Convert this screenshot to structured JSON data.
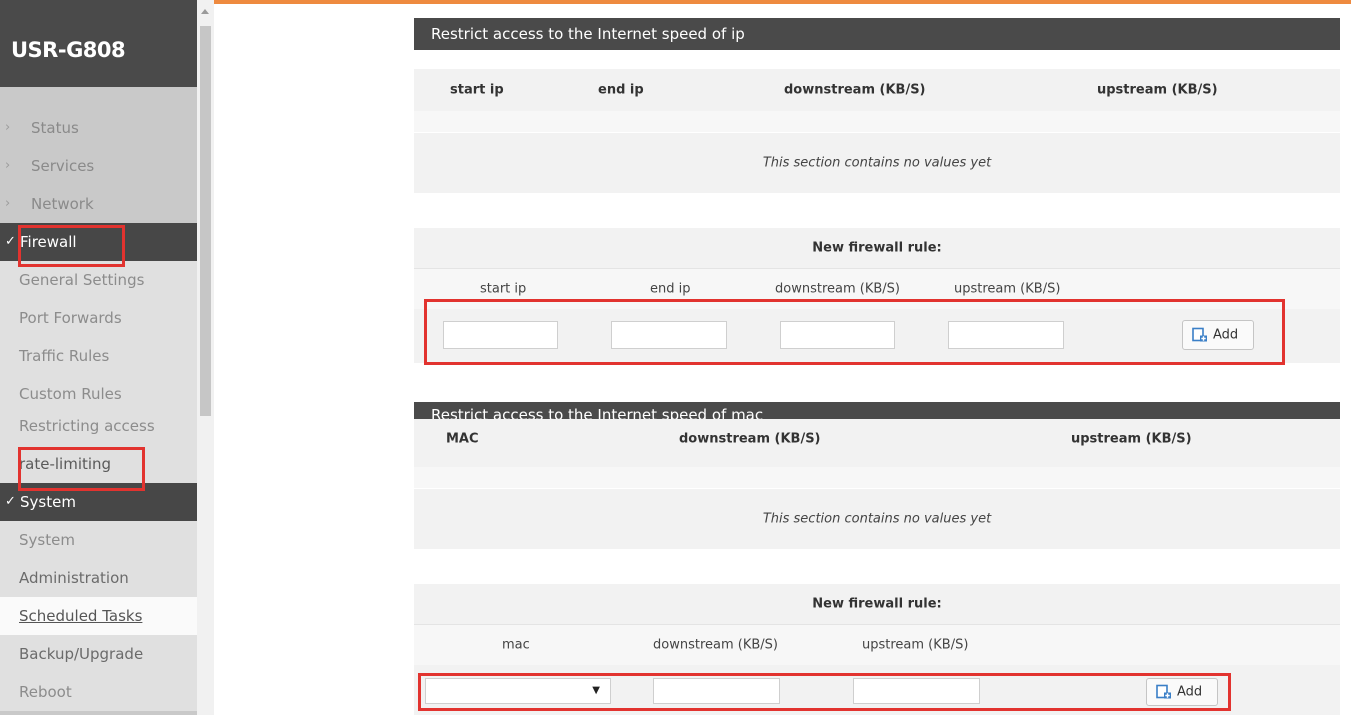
{
  "app": {
    "title": "USR-G808"
  },
  "sidebar": {
    "items": [
      {
        "label": "Status"
      },
      {
        "label": "Services"
      },
      {
        "label": "Network"
      },
      {
        "label": "Firewall"
      },
      {
        "label": "General Settings"
      },
      {
        "label": "Port Forwards"
      },
      {
        "label": "Traffic Rules"
      },
      {
        "label": "Custom Rules"
      },
      {
        "label": "Restricting access"
      },
      {
        "label": "rate-limiting"
      },
      {
        "label": "System"
      },
      {
        "label": "System"
      },
      {
        "label": "Administration"
      },
      {
        "label": "Scheduled Tasks"
      },
      {
        "label": "Backup/Upgrade"
      },
      {
        "label": "Reboot"
      }
    ]
  },
  "ip_section": {
    "title": "Restrict access to the Internet speed of ip",
    "columns": [
      "start ip",
      "end ip",
      "downstream (KB/S)",
      "upstream (KB/S)"
    ],
    "empty_message": "This section contains no values yet",
    "new_rule_title": "New firewall rule:",
    "new_rule_columns": [
      "start ip",
      "end ip",
      "downstream (KB/S)",
      "upstream (KB/S)"
    ],
    "inputs": {
      "start_ip": "",
      "end_ip": "",
      "downstream": "",
      "upstream": ""
    },
    "add_label": "Add"
  },
  "mac_section": {
    "title": "Restrict access to the Internet speed of mac",
    "columns": [
      "MAC",
      "downstream (KB/S)",
      "upstream (KB/S)"
    ],
    "empty_message": "This section contains no values yet",
    "new_rule_title": "New firewall rule:",
    "new_rule_columns": [
      "mac",
      "downstream (KB/S)",
      "upstream (KB/S)"
    ],
    "inputs": {
      "mac": "",
      "downstream": "",
      "upstream": ""
    },
    "add_label": "Add"
  },
  "colors": {
    "accent_line": "#ee8a3f",
    "header_bg": "#4a4a4a",
    "highlight_box": "#e2332f"
  }
}
